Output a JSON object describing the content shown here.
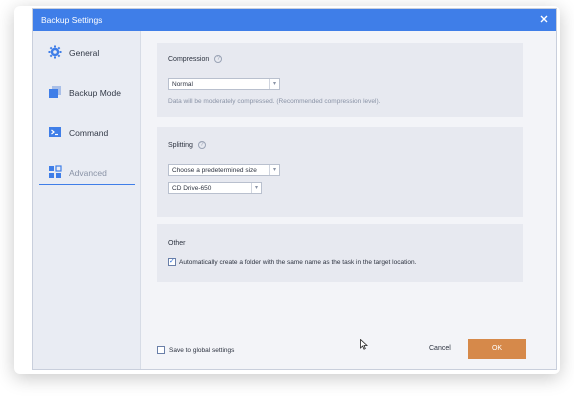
{
  "window": {
    "title": "Backup Settings",
    "close_icon": "close-icon"
  },
  "sidebar": {
    "items": [
      {
        "label": "General",
        "icon": "gear-icon"
      },
      {
        "label": "Backup Mode",
        "icon": "backup-mode-icon"
      },
      {
        "label": "Command",
        "icon": "terminal-icon"
      },
      {
        "label": "Advanced",
        "icon": "advanced-grid-icon",
        "active": true
      }
    ]
  },
  "compression": {
    "title": "Compression",
    "selected": "Normal",
    "description": "Data will be moderately compressed. (Recommended compression level)."
  },
  "splitting": {
    "title": "Splitting",
    "mode_selected": "Choose a predetermined size",
    "size_selected": "CD Drive-650"
  },
  "other": {
    "title": "Other",
    "auto_folder_label": "Automatically create a folder with the same name as the task in the target location.",
    "auto_folder_checked": true
  },
  "footer": {
    "save_global_label": "Save to global settings",
    "save_global_checked": false,
    "cancel_label": "Cancel",
    "ok_label": "OK"
  },
  "colors": {
    "titlebar": "#3f7ee8",
    "ok_button": "#d6894a",
    "accent": "#3f7ee8"
  }
}
